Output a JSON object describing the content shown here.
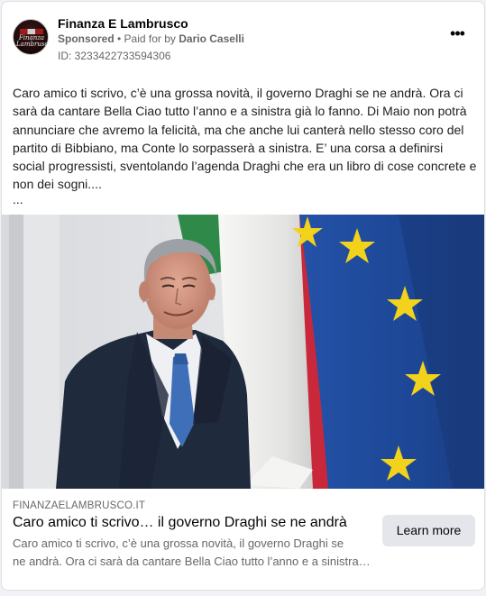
{
  "post": {
    "page_name": "Finanza E Lambrusco",
    "avatar_text_line1": "Finanza",
    "avatar_text_line2": "Lambrusco",
    "sponsored_label": "Sponsored",
    "paid_for_prefix": " • Paid for by ",
    "paid_for_name": "Dario Caselli",
    "ad_id": "ID: 3233422733594306",
    "more_icon": "three-dots-icon",
    "body_text": "Caro amico ti scrivo, c’è una grossa novità, il governo Draghi se ne andrà. Ora ci sarà da cantare Bella Ciao tutto l’anno e a sinistra già lo fanno. Di Maio non potrà annunciare che avremo la felicità, ma che anche lui canterà nello stesso coro del partito di Bibbiano, ma Conte lo sorpasserà a sinistra. E’ una corsa a definirsi social progressisti, sventolando l’agenda Draghi che era un libro di cose concrete e non dei sogni....",
    "see_more": "..."
  },
  "link": {
    "domain": "FINANZAELAMBRUSCO.IT",
    "headline": "Caro amico ti scrivo… il governo Draghi se ne andrà",
    "description_line1": "Caro amico ti scrivo, c’è una grossa novità, il governo Draghi se",
    "description_line2": "ne andrà. Ora ci sarà da cantare Bella Ciao tutto l’anno e a sinistra già lo fanno.",
    "cta_label": "Learn more"
  },
  "colors": {
    "eu_blue": "#1e4a9c",
    "eu_star": "#f2d21b",
    "italy_green": "#2f8a4a",
    "italy_red": "#c8283a",
    "cta_bg": "#e4e6eb"
  }
}
